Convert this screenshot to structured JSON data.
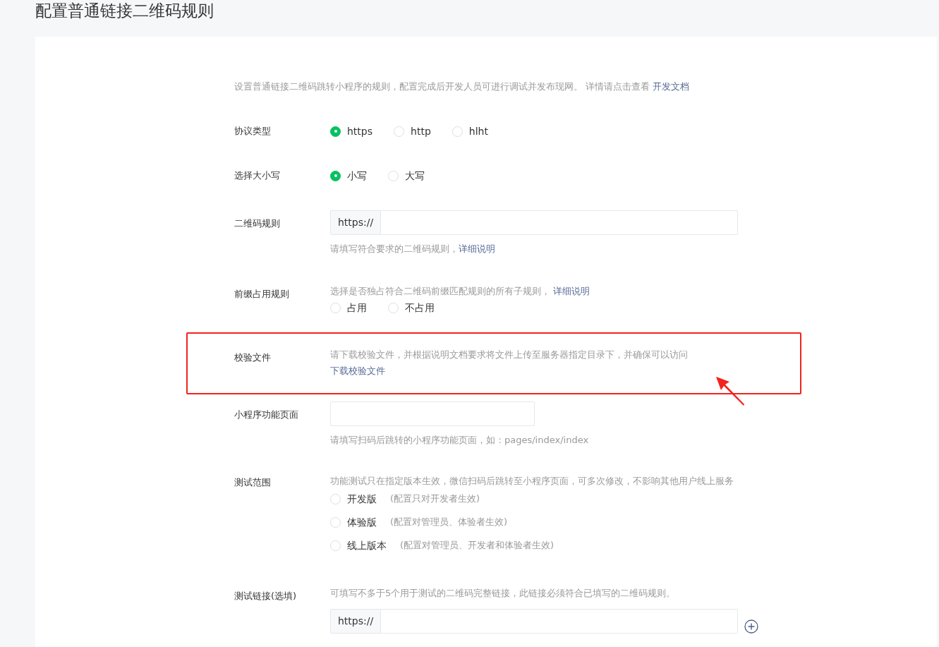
{
  "page_title": "配置普通链接二维码规则",
  "intro": {
    "text": "设置普通链接二维码跳转小程序的规则，配置完成后开发人员可进行调试并发布现网。 详情请点击查看",
    "link": "开发文档"
  },
  "fields": [
    {
      "kind": "radio",
      "label": "协议类型",
      "options": [
        {
          "label": "https",
          "selected": true
        },
        {
          "label": "http",
          "selected": false
        },
        {
          "label": "hlht",
          "selected": false
        }
      ]
    },
    {
      "kind": "radio",
      "label": "选择大小写",
      "options": [
        {
          "label": "小写",
          "selected": true
        },
        {
          "label": "大写",
          "selected": false
        }
      ]
    },
    {
      "kind": "prefixed_input",
      "label": "二维码规则",
      "prefix": "https://",
      "hint": "请填写符合要求的二维码规则，",
      "hint_link": "详细说明"
    },
    {
      "kind": "radio_note",
      "label": "前缀占用规则",
      "note": "选择是否独占符合二维码前缀匹配规则的所有子规则，",
      "note_link": "详细说明",
      "options": [
        {
          "label": "占用",
          "selected": false
        },
        {
          "label": "不占用",
          "selected": false
        }
      ]
    },
    {
      "kind": "download",
      "label": "校验文件",
      "note": "请下载校验文件，并根据说明文档要求将文件上传至服务器指定目录下，并确保可以访问",
      "link": "下载校验文件",
      "highlighted": true
    },
    {
      "kind": "text_input",
      "label": "小程序功能页面",
      "hint": "请填写扫码后跳转的小程序功能页面，如：pages/index/index"
    },
    {
      "kind": "radio_list",
      "label": "测试范围",
      "note": "功能测试只在指定版本生效，微信扫码后跳转至小程序页面，可多次修改，不影响其他用户线上服务",
      "options": [
        {
          "label": "开发版",
          "description": "(配置只对开发者生效)",
          "selected": false
        },
        {
          "label": "体验版",
          "description": "(配置对管理员、体验者生效)",
          "selected": false
        },
        {
          "label": "线上版本",
          "description": "(配置对管理员、开发者和体验者生效)",
          "selected": false
        }
      ]
    },
    {
      "kind": "link_list",
      "label": "测试链接(选填)",
      "note": "可填写不多于5个用于测试的二维码完整链接，此链接必须符合已填写的二维码规则。",
      "prefix": "https://"
    }
  ]
}
